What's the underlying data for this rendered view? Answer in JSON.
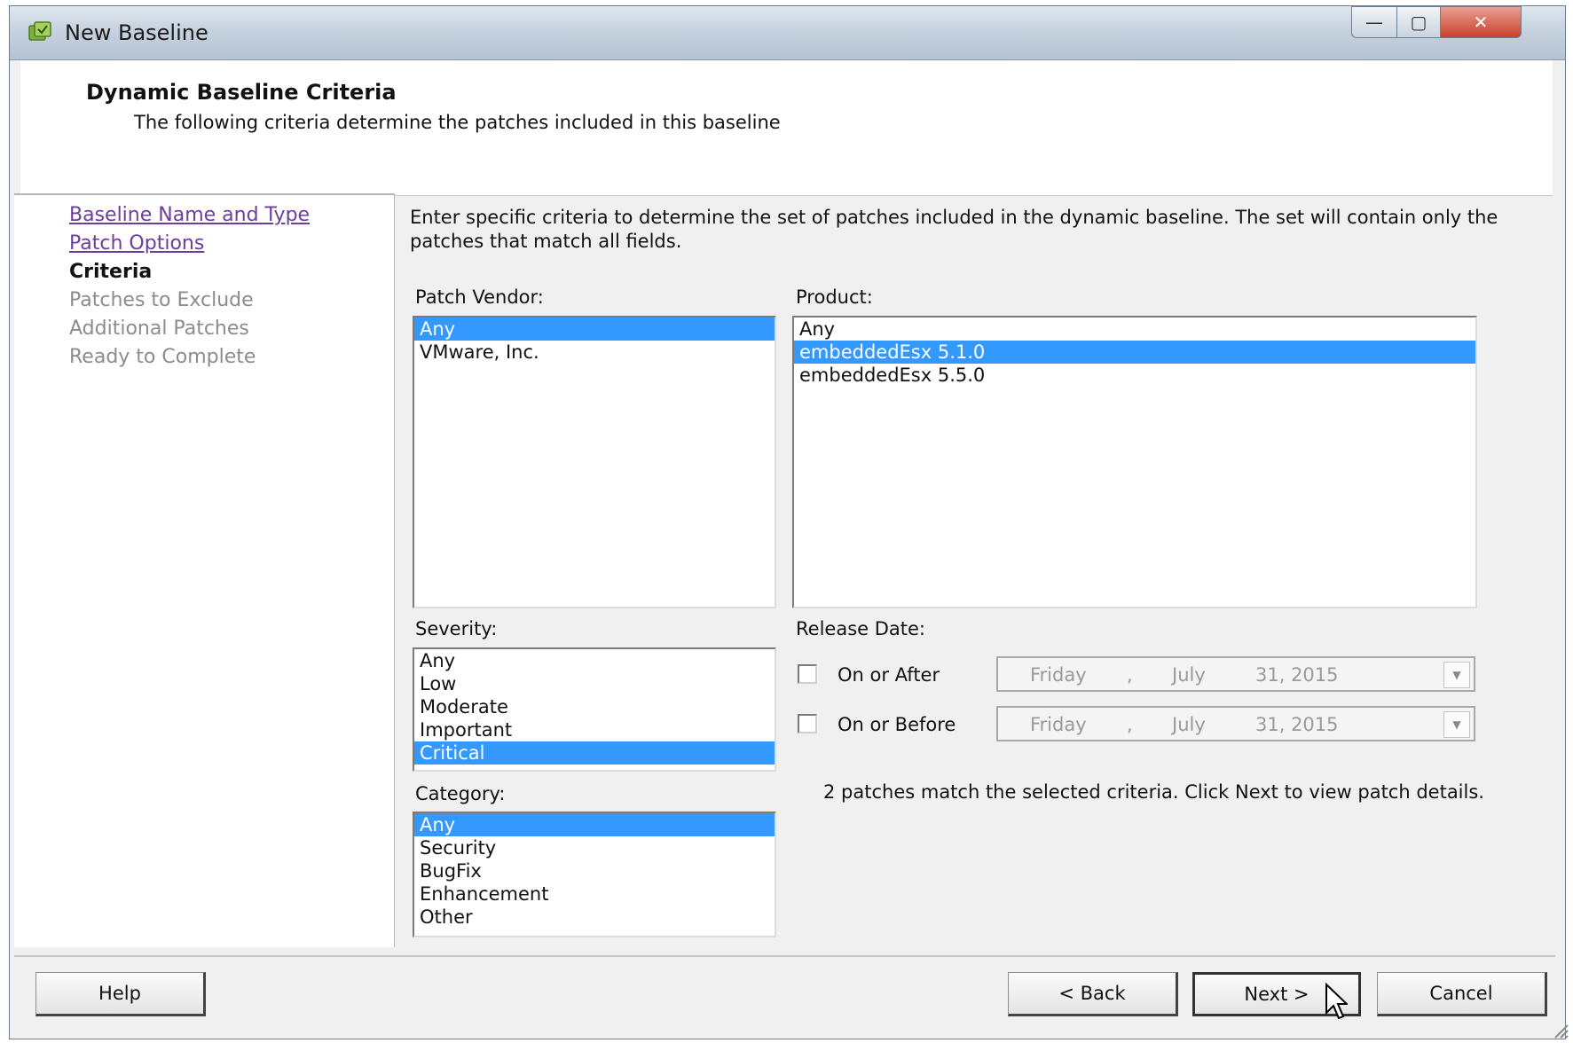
{
  "window": {
    "title": "New Baseline",
    "minimize_glyph": "—",
    "maximize_glyph": "▢",
    "close_glyph": "✕"
  },
  "header": {
    "title": "Dynamic Baseline Criteria",
    "subtitle": "The following criteria determine the patches included in this baseline"
  },
  "nav": {
    "items": [
      {
        "label": "Baseline Name and Type",
        "state": "visited"
      },
      {
        "label": "Patch Options",
        "state": "visited"
      },
      {
        "label": "Criteria",
        "state": "current"
      },
      {
        "label": "Patches to Exclude",
        "state": "disabled"
      },
      {
        "label": "Additional Patches",
        "state": "disabled"
      },
      {
        "label": "Ready to Complete",
        "state": "disabled"
      }
    ]
  },
  "instructions": "Enter specific criteria to determine the set of patches included in the dynamic baseline.  The set will contain only the patches that match all fields.",
  "vendor": {
    "label": "Patch Vendor:",
    "items": [
      "Any",
      "VMware, Inc."
    ],
    "selected": "Any"
  },
  "product": {
    "label": "Product:",
    "items": [
      "Any",
      "embeddedEsx 5.1.0",
      "embeddedEsx 5.5.0"
    ],
    "selected": "embeddedEsx 5.1.0"
  },
  "severity": {
    "label": "Severity:",
    "items": [
      "Any",
      "Low",
      "Moderate",
      "Important",
      "Critical"
    ],
    "selected": "Critical"
  },
  "category": {
    "label": "Category:",
    "items": [
      "Any",
      "Security",
      "BugFix",
      "Enhancement",
      "Other"
    ],
    "selected": "Any"
  },
  "release_date": {
    "label": "Release Date:",
    "on_or_after": {
      "label": "On or After",
      "checked": false,
      "weekday": "Friday",
      "month": "July",
      "date": "31, 2015"
    },
    "on_or_before": {
      "label": "On or Before",
      "checked": false,
      "weekday": "Friday",
      "month": "July",
      "date": "31, 2015"
    },
    "separator": ","
  },
  "match_message": "2 patches match the selected criteria. Click Next to view patch details.",
  "footer": {
    "help": "Help",
    "back": "< Back",
    "next": "Next >",
    "cancel": "Cancel"
  },
  "colors": {
    "selection": "#3399ff",
    "visited_link": "#6d3d9c",
    "disabled_text": "#8c8c8c"
  }
}
